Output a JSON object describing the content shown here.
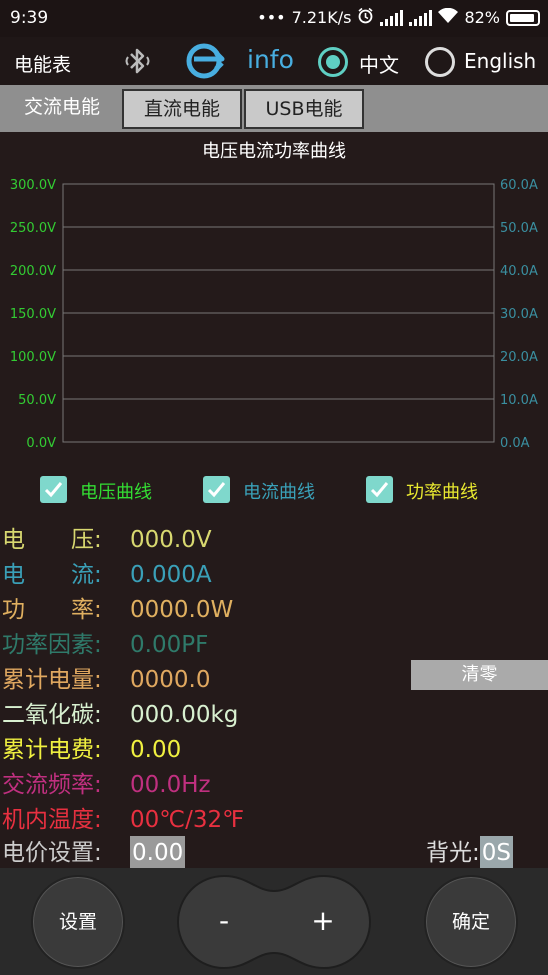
{
  "status_bar": {
    "time": "9:39",
    "dots": "•••",
    "speed": "7.21K/s",
    "battery": "82%"
  },
  "top_bar": {
    "title": "电能表",
    "info": "info",
    "lang_chinese": "中文",
    "lang_english": "English",
    "selected_lang": "中文"
  },
  "tabs": [
    {
      "label": "交流电能",
      "active": true
    },
    {
      "label": "直流电能",
      "active": false
    },
    {
      "label": "USB电能",
      "active": false
    }
  ],
  "chart_data": {
    "type": "line",
    "title": "电压电流功率曲线",
    "y_left_ticks": [
      "300.0V",
      "250.0V",
      "200.0V",
      "150.0V",
      "100.0V",
      "50.0V",
      "0.0V"
    ],
    "y_right_ticks": [
      "60.0A",
      "50.0A",
      "40.0A",
      "30.0A",
      "20.0A",
      "10.0A",
      "0.0A"
    ],
    "ylim_left": [
      0,
      300
    ],
    "ylim_right": [
      0,
      60
    ],
    "grid": true,
    "series": []
  },
  "checkboxes": [
    {
      "label": "电压曲线",
      "checked": true,
      "color": "#33dd33"
    },
    {
      "label": "电流曲线",
      "checked": true,
      "color": "#3aa0b8"
    },
    {
      "label": "功率曲线",
      "checked": true,
      "color": "#e8e830"
    }
  ],
  "readings": {
    "voltage": {
      "label": "电　　压:",
      "value": "000.0V",
      "color": "#d8d870"
    },
    "current": {
      "label": "电　　流:",
      "value": "0.000A",
      "color": "#3aa0b8"
    },
    "power": {
      "label": "功　　率:",
      "value": "0000.0W",
      "color": "#e0b060"
    },
    "power_factor": {
      "label": "功率因素:",
      "value": "0.00PF",
      "color": "#2f7a6a"
    },
    "energy": {
      "label": "累计电量:",
      "value": "0000.0",
      "color": "#e0a860"
    },
    "co2": {
      "label": "二氧化碳:",
      "value": "000.00kg",
      "color": "#d8f0d0"
    },
    "cost": {
      "label": "累计电费:",
      "value": "0.00",
      "color": "#f0f040"
    },
    "frequency": {
      "label": "交流频率:",
      "value": "00.0Hz",
      "color": "#c03080"
    },
    "temperature": {
      "label": "机内温度:",
      "value": "00℃/32℉",
      "color": "#e83040"
    },
    "price": {
      "label": "电价设置:",
      "value": "0.00",
      "color": "#cccccc"
    }
  },
  "clear_button": "清零",
  "backlight": {
    "label": "背光:",
    "value": "0S"
  },
  "bottom": {
    "settings": "设置",
    "minus": "-",
    "plus": "+",
    "confirm": "确定"
  }
}
